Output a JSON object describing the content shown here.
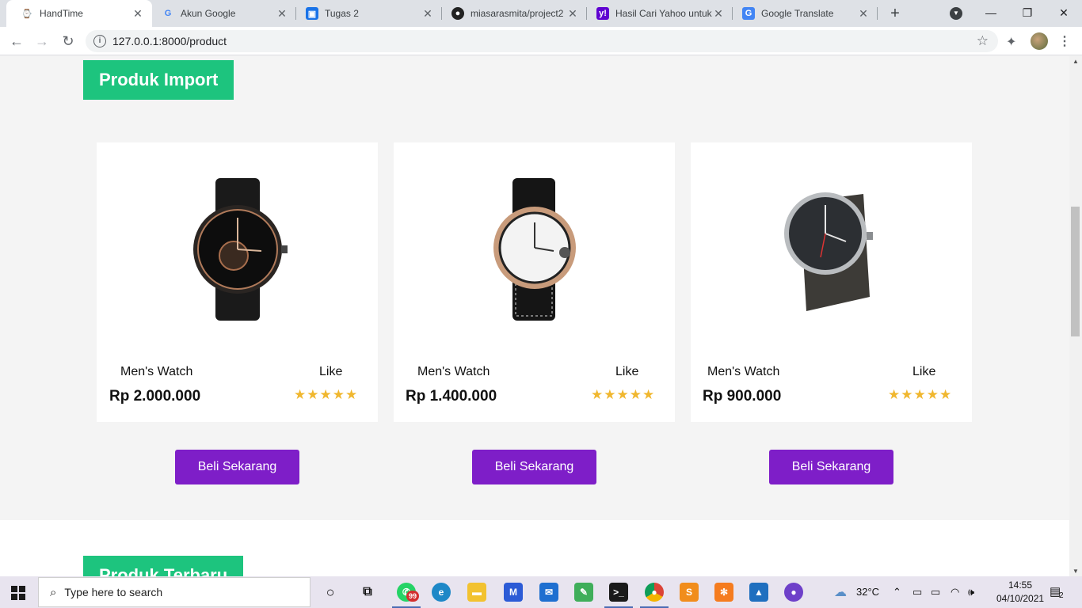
{
  "browser": {
    "tabs": [
      {
        "title": "HandTime",
        "active": true,
        "icon": "handtime-favicon"
      },
      {
        "title": "Akun Google",
        "icon": "google-icon"
      },
      {
        "title": "Tugas 2",
        "icon": "classroom-icon"
      },
      {
        "title": "miasarasmita/project2",
        "icon": "github-icon"
      },
      {
        "title": "Hasil Cari Yahoo untuk",
        "icon": "yahoo-icon"
      },
      {
        "title": "Google Translate",
        "icon": "translate-icon"
      }
    ],
    "url": "127.0.0.1:8000/product"
  },
  "page": {
    "section_title": "Produk Import",
    "next_section_title": "Produk Terbaru",
    "colors": {
      "accent_green": "#1dc47e",
      "button_purple": "#7e1ec8",
      "star_gold": "#f0b72f"
    },
    "products": [
      {
        "name": "Men's Watch",
        "price": "Rp 2.000.000",
        "like_label": "Like",
        "rating": 5,
        "stars": "★★★★★",
        "button_label": "Beli Sekarang"
      },
      {
        "name": "Men's Watch",
        "price": "Rp 1.400.000",
        "like_label": "Like",
        "rating": 5,
        "stars": "★★★★★",
        "button_label": "Beli Sekarang"
      },
      {
        "name": "Men's Watch",
        "price": "Rp 900.000",
        "like_label": "Like",
        "rating": 5,
        "stars": "★★★★★",
        "button_label": "Beli Sekarang"
      }
    ]
  },
  "taskbar": {
    "search_placeholder": "Type here to search",
    "whatsapp_badge": "99",
    "weather": "32°C",
    "time": "14:55",
    "date": "04/10/2021",
    "notifications": "2"
  }
}
